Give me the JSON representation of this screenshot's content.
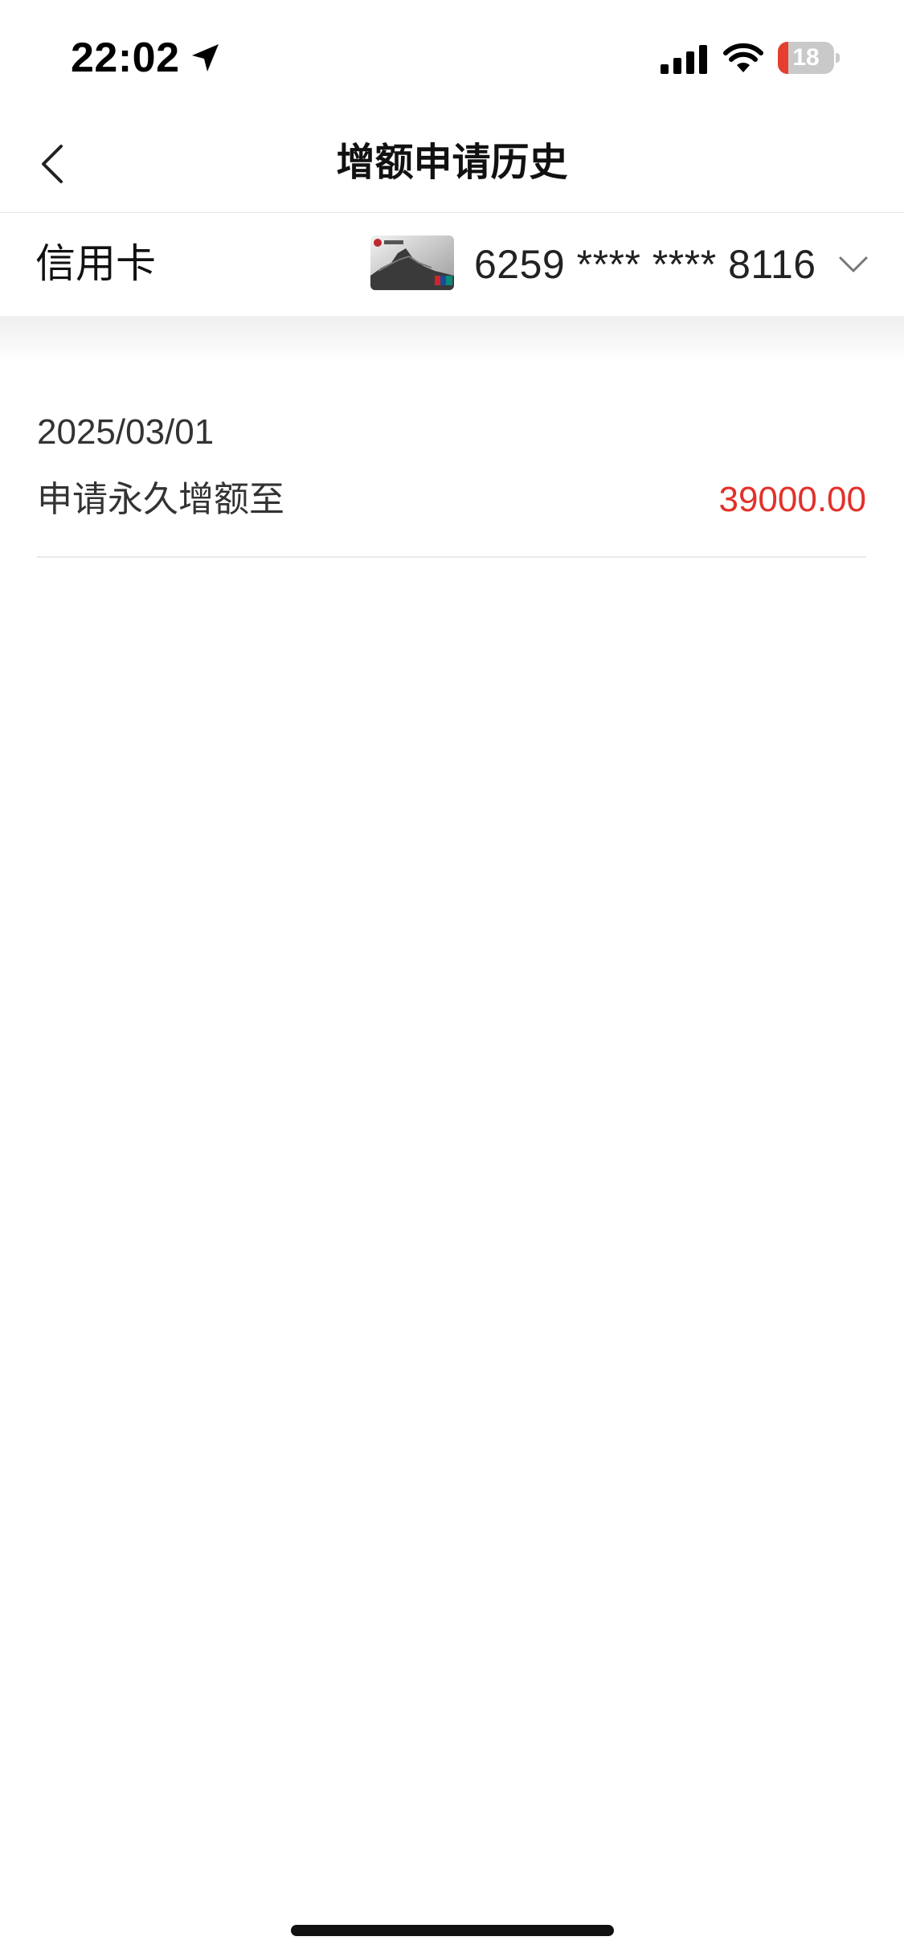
{
  "status_bar": {
    "time": "22:02",
    "battery_level": "18",
    "battery_fraction": 0.18,
    "location_icon": "location-arrow-icon",
    "signal_icon": "cellular-signal-icon",
    "wifi_icon": "wifi-icon"
  },
  "header": {
    "title": "增额申请历史",
    "back_icon": "chevron-left-icon"
  },
  "card_selector": {
    "label": "信用卡",
    "card_number": "6259 **** **** 8116",
    "dropdown_icon": "chevron-down-icon"
  },
  "history": {
    "items": [
      {
        "date": "2025/03/01",
        "description": "申请永久增额至",
        "amount": "39000.00"
      }
    ]
  },
  "colors": {
    "accent_red": "#e1322b",
    "battery_low": "#e53e2f",
    "divider": "#e8e8e8"
  }
}
